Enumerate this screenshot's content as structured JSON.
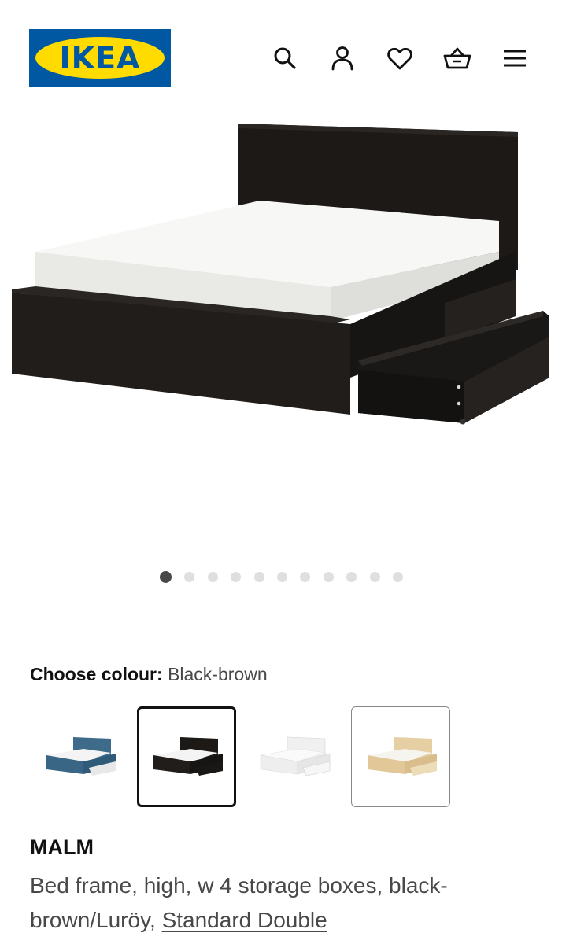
{
  "header": {
    "logo_text": "IKEA",
    "icons": [
      "search-icon",
      "account-icon",
      "favourites-icon",
      "basket-icon",
      "menu-icon"
    ]
  },
  "gallery": {
    "image_count": 11,
    "active_index": 0
  },
  "colour": {
    "label": "Choose colour:",
    "selected": "Black-brown",
    "options": [
      {
        "name": "blue",
        "hex": "#3e6b8a"
      },
      {
        "name": "black-brown",
        "hex": "#1f1c1a",
        "selected": true
      },
      {
        "name": "white",
        "hex": "#f2f2f2"
      },
      {
        "name": "white stained oak veneer",
        "hex": "#e6cfa3"
      }
    ]
  },
  "product": {
    "name": "MALM",
    "description": "Bed frame, high, w 4 storage boxes, black-brown/Luröy,",
    "size_link": "Standard Double"
  },
  "colors": {
    "ikea_blue": "#0058a3",
    "ikea_yellow": "#ffdb00",
    "text_primary": "#111111",
    "text_secondary": "#484848"
  }
}
